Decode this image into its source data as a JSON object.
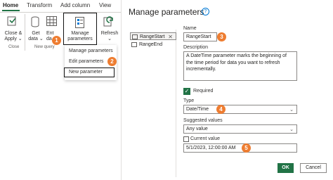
{
  "ribbon": {
    "tabs": [
      "Home",
      "Transform",
      "Add column",
      "View"
    ],
    "buttons": {
      "close_apply": [
        "Close &",
        "Apply ⌄"
      ],
      "get_data": [
        "Get",
        "data ⌄"
      ],
      "enter_data": [
        "Ent",
        "da"
      ],
      "manage_parameters": [
        "Manage",
        "parameters ⌄"
      ],
      "refresh": [
        "Refresh",
        "⌄"
      ]
    },
    "groups": {
      "close": "Close",
      "new_query": "New query"
    }
  },
  "menu": {
    "items": [
      "Manage parameters",
      "Edit parameters",
      "New parameter"
    ]
  },
  "dialog": {
    "title": "Manage parameters",
    "help_glyph": "?",
    "parameters": [
      {
        "name": "RangeStart",
        "close": "✕"
      },
      {
        "name": "RangeEnd"
      }
    ],
    "fields": {
      "name_label": "Name",
      "name_value": "RangeStart",
      "description_label": "Description",
      "description_value": "A DateTime parameter marks the beginning of the time period for data you want to refresh incrementally.",
      "required_label": "Required",
      "type_label": "Type",
      "type_value": "Date/Time",
      "suggested_label": "Suggested values",
      "suggested_value": "Any value",
      "current_label": "Current value",
      "current_value": "5/1/2023, 12:00:00 AM"
    },
    "ok_label": "OK",
    "cancel_label": "Cancel"
  },
  "callouts": [
    "1",
    "2",
    "3",
    "4",
    "5"
  ],
  "colors": {
    "accent": "#217346",
    "callout": "#ee7d31"
  }
}
